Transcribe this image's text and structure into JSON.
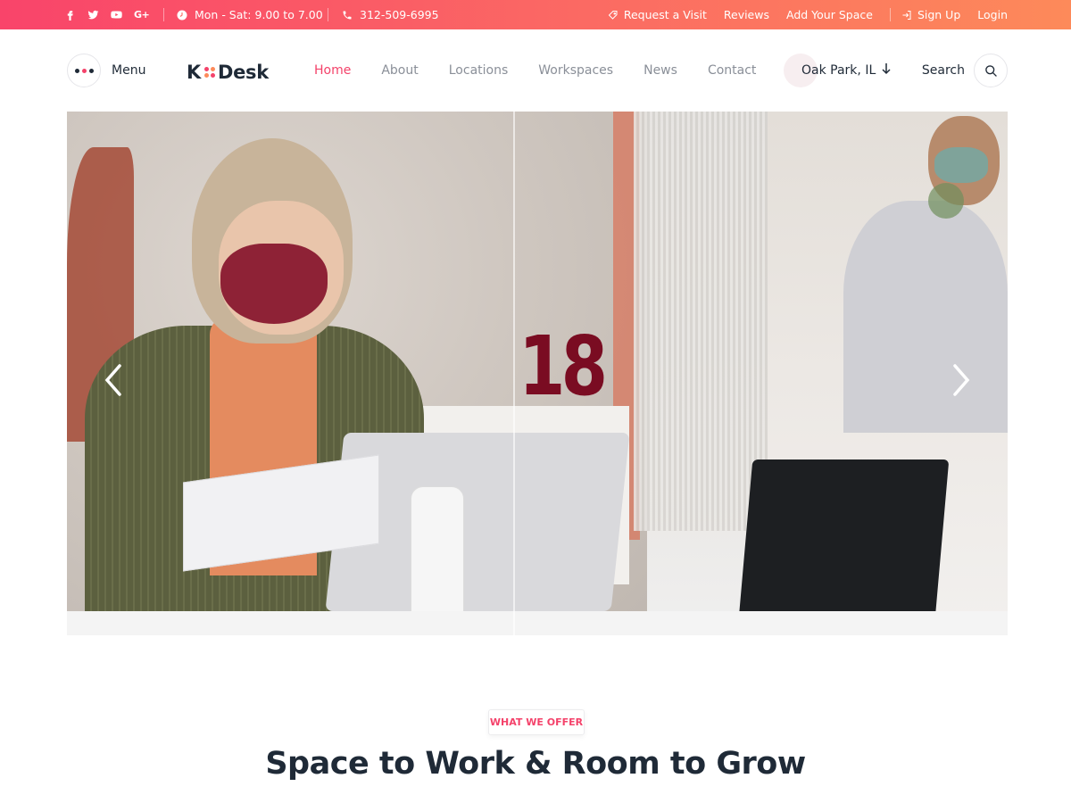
{
  "topbar": {
    "social_icons": [
      "facebook-icon",
      "twitter-icon",
      "youtube-icon",
      "google-plus-icon"
    ],
    "google_plus_text": "G+",
    "hours": "Mon - Sat: 9.00 to 7.00",
    "phone": "312-509-6995",
    "links": {
      "request_visit": "Request a Visit",
      "reviews": "Reviews",
      "add_space": "Add Your Space",
      "sign_up": "Sign Up",
      "login": "Login"
    },
    "gradient_colors": [
      "#f9446a",
      "#fd8a5a"
    ]
  },
  "header": {
    "menu_label": "Menu",
    "menu_dot_colors": [
      "#1f2a37",
      "#f4426a",
      "#1f2a37"
    ],
    "logo": {
      "left": "K",
      "right": "Desk",
      "mark_colors": [
        "#f4426a",
        "#fd8a5a",
        "#fd8a5a",
        "#f4426a"
      ]
    },
    "nav": [
      {
        "label": "Home",
        "active": true
      },
      {
        "label": "About",
        "active": false
      },
      {
        "label": "Locations",
        "active": false
      },
      {
        "label": "Workspaces",
        "active": false
      },
      {
        "label": "News",
        "active": false
      },
      {
        "label": "Contact",
        "active": false
      }
    ],
    "location": "Oak Park, IL",
    "search_label": "Search"
  },
  "hero": {
    "counter": "18",
    "prev_icon": "chevron-left-icon",
    "next_icon": "chevron-right-icon"
  },
  "offer": {
    "badge": "WHAT WE OFFER",
    "title": "Space to Work & Room to Grow"
  },
  "colors": {
    "accent": "#f4426a",
    "text_dark": "#1f2a37",
    "nav_muted": "#8a8f98",
    "counter": "#7a0c22"
  }
}
